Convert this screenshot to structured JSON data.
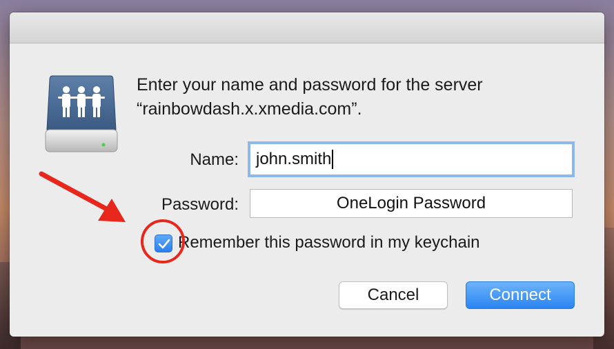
{
  "dialog": {
    "message_line1": "Enter your name and password for the server",
    "message_line2": "“rainbowdash.x.xmedia.com”.",
    "server_icon": "shared-server-icon"
  },
  "form": {
    "name_label": "Name:",
    "name_value": "john.smith",
    "password_label": "Password:",
    "password_value": "OneLogin Password",
    "remember_label": "Remember this password in my keychain",
    "remember_checked": true
  },
  "buttons": {
    "cancel": "Cancel",
    "connect": "Connect"
  },
  "annotations": {
    "arrow": "red-arrow-icon",
    "circle": "red-circle-highlight",
    "color": "#e8271c"
  },
  "colors": {
    "accent": "#2a84f1",
    "dialog_bg": "#ececec"
  }
}
